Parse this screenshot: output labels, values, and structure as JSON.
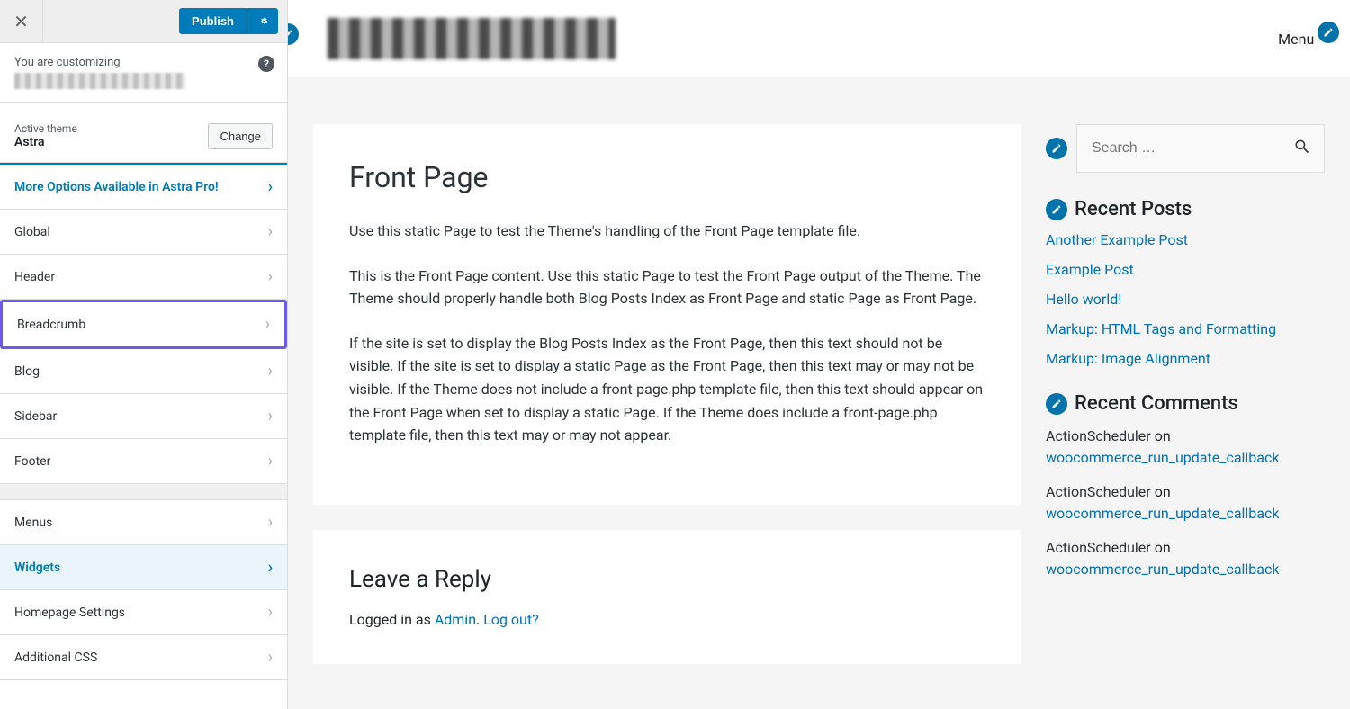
{
  "topbar": {
    "publish_label": "Publish"
  },
  "customizing": {
    "text": "You are customizing"
  },
  "theme": {
    "label": "Active theme",
    "name": "Astra",
    "change_label": "Change"
  },
  "menu": {
    "promo": "More Options Available in Astra Pro!",
    "global": "Global",
    "header": "Header",
    "breadcrumb": "Breadcrumb",
    "blog": "Blog",
    "sidebar": "Sidebar",
    "footer": "Footer",
    "menus": "Menus",
    "widgets": "Widgets",
    "homepage": "Homepage Settings",
    "additional_css": "Additional CSS"
  },
  "preview_header": {
    "menu_label": "Menu"
  },
  "page": {
    "title": "Front Page",
    "p1": "Use this static Page to test the Theme's handling of the Front Page template file.",
    "p2": "This is the Front Page content. Use this static Page to test the Front Page output of the Theme. The Theme should properly handle both Blog Posts Index as Front Page and static Page as Front Page.",
    "p3": "If the site is set to display the Blog Posts Index as the Front Page, then this text should not be visible. If the site is set to display a static Page as the Front Page, then this text may or may not be visible. If the Theme does not include a front-page.php template file, then this text should appear on the Front Page when set to display a static Page. If the Theme does include a front-page.php template file, then this text may or may not appear."
  },
  "reply": {
    "title": "Leave a Reply",
    "logged_in_prefix": "Logged in as ",
    "admin": "Admin",
    "logout": "Log out?"
  },
  "search": {
    "placeholder": "Search …"
  },
  "recent_posts": {
    "title": "Recent Posts",
    "items": [
      "Another Example Post",
      "Example Post",
      "Hello world!",
      "Markup: HTML Tags and Formatting",
      "Markup: Image Alignment"
    ]
  },
  "recent_comments": {
    "title": "Recent Comments",
    "items": [
      {
        "author": "ActionScheduler",
        "on": " on ",
        "target": "woocommerce_run_update_callback"
      },
      {
        "author": "ActionScheduler",
        "on": " on ",
        "target": "woocommerce_run_update_callback"
      },
      {
        "author": "ActionScheduler",
        "on": " on ",
        "target": "woocommerce_run_update_callback"
      }
    ]
  }
}
